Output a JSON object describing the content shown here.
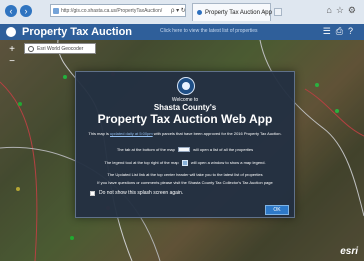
{
  "browser": {
    "address": "http://gis.co.shasta.ca.us/PropertyTaxAuction/",
    "address_tools": "ρ ▾ ↻",
    "tab_title": "Property Tax Auction App",
    "tab_close": "×",
    "tool_icons": [
      "home-icon",
      "star-icon",
      "gear-icon"
    ]
  },
  "app": {
    "title": "Property Tax Auction",
    "header_link": "Click here to view the latest list of properties",
    "header_icons": [
      "list-icon",
      "print-icon",
      "help-icon"
    ]
  },
  "map": {
    "search_placeholder": "Esri World Geocoder",
    "zoom_in": "+",
    "zoom_out": "−",
    "esri_logo": "esri"
  },
  "splash": {
    "welcome_text": "Welcome to",
    "county_text": "Shasta County's",
    "title": "Property Tax Auction Web App",
    "paragraph_1_prefix": "This map is",
    "paragraph_1_link": "updated daily at 5:00pm",
    "paragraph_1_suffix": "with parcels that have been approved for the 2016 Property Tax Auction.",
    "paragraph_2_prefix": "The tab at the bottom of the map",
    "paragraph_2_suffix": "will open a list of all the properties",
    "paragraph_3_prefix": "The legend tool at the top right of the map",
    "paragraph_3_suffix": "will open a window to show a map legend.",
    "paragraph_4": "The Updated List link at the top center header will take you to the latest list of properties",
    "paragraph_5": "If you have questions or comments please visit the Shasta County Tax Collector's Tax Auction page",
    "checkbox_label": "Do not show this splash screen again.",
    "ok_label": "OK"
  }
}
